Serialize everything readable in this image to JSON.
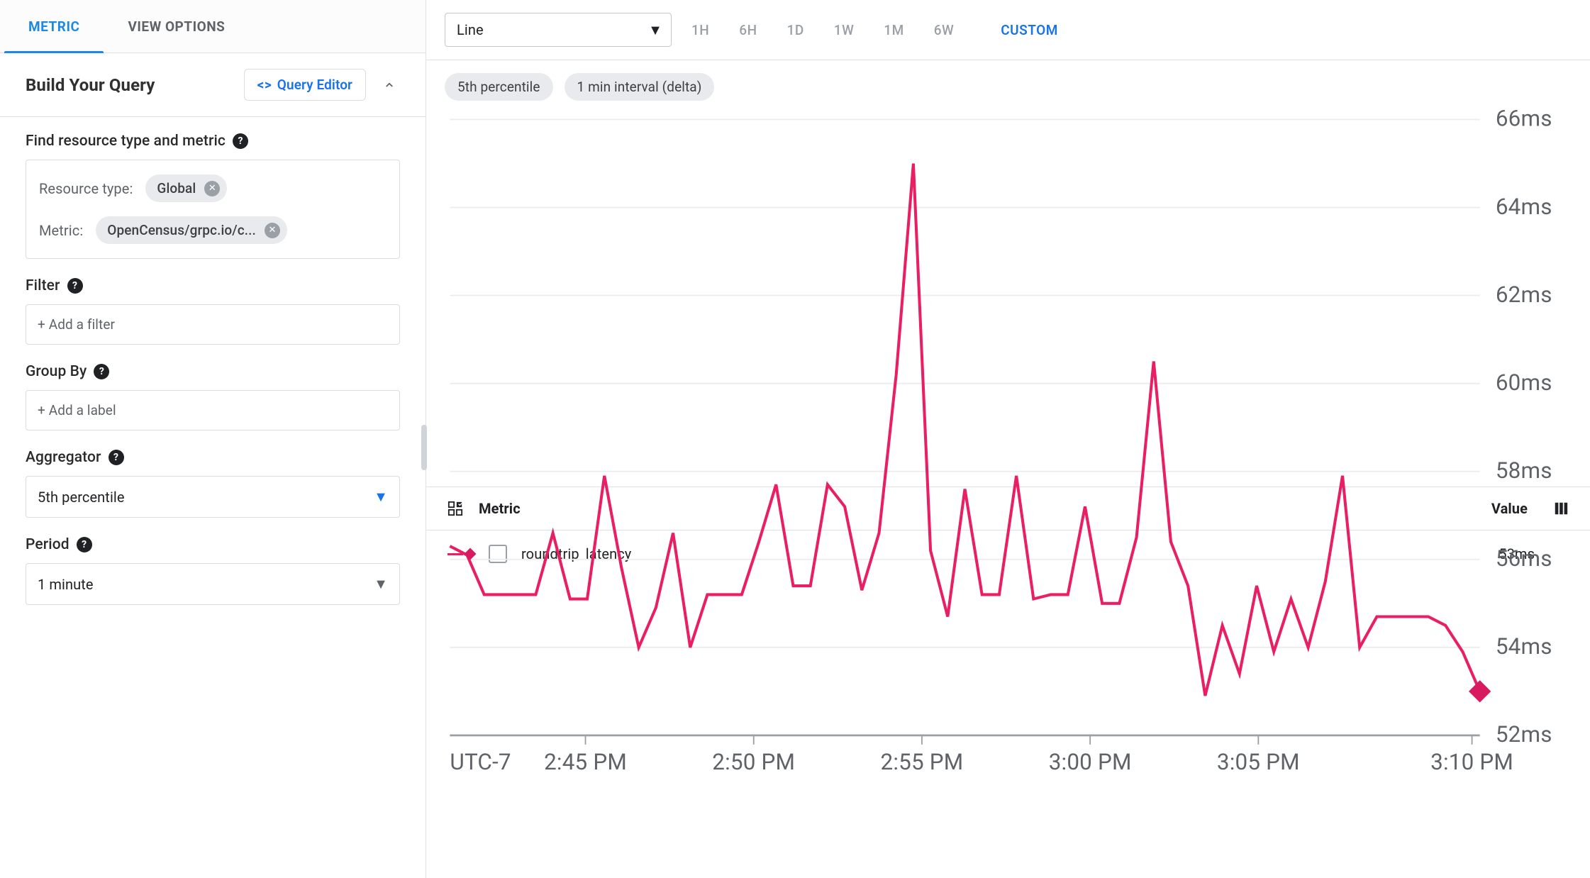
{
  "tabs": {
    "metric": "METRIC",
    "view_options": "VIEW OPTIONS"
  },
  "builder": {
    "title": "Build Your Query",
    "query_editor_btn": "Query Editor",
    "find_label": "Find resource type and metric",
    "resource_type_label": "Resource type:",
    "resource_type_value": "Global",
    "metric_label": "Metric:",
    "metric_value": "OpenCensus/grpc.io/c...",
    "filter_label": "Filter",
    "filter_placeholder": "+ Add a filter",
    "groupby_label": "Group By",
    "groupby_placeholder": "+ Add a label",
    "aggregator_label": "Aggregator",
    "aggregator_value": "5th percentile",
    "period_label": "Period",
    "period_value": "1 minute"
  },
  "right": {
    "chart_type": "Line",
    "ranges": [
      "1H",
      "6H",
      "1D",
      "1W",
      "1M",
      "6W"
    ],
    "custom": "CUSTOM",
    "badge1": "5th percentile",
    "badge2": "1 min interval (delta)",
    "legend_metric": "Metric",
    "legend_value": "Value",
    "series_name": "roundtrip_latency",
    "series_value": "53ms",
    "tz": "UTC-7"
  },
  "chart_data": {
    "type": "line",
    "title": "",
    "xlabel": "",
    "ylabel": "",
    "ylim": [
      52,
      66
    ],
    "y_ticks": [
      52,
      54,
      56,
      58,
      60,
      62,
      64,
      66
    ],
    "y_tick_labels": [
      "52ms",
      "54ms",
      "56ms",
      "58ms",
      "60ms",
      "62ms",
      "64ms",
      "66ms"
    ],
    "x_tick_labels": [
      "2:45 PM",
      "2:50 PM",
      "2:55 PM",
      "3:00 PM",
      "3:05 PM",
      "3:10 PM"
    ],
    "timezone_label": "UTC-7",
    "series": [
      {
        "name": "roundtrip_latency",
        "color": "#e91e63",
        "values": [
          56.3,
          56.1,
          55.2,
          55.2,
          55.2,
          55.2,
          56.6,
          55.1,
          55.1,
          57.9,
          55.8,
          54.0,
          54.9,
          56.6,
          54.0,
          55.2,
          55.2,
          55.2,
          56.4,
          57.7,
          55.4,
          55.4,
          57.7,
          57.2,
          55.3,
          56.6,
          60.2,
          65.0,
          56.2,
          54.7,
          57.6,
          55.2,
          55.2,
          57.9,
          55.1,
          55.2,
          55.2,
          57.2,
          55.0,
          55.0,
          56.5,
          60.5,
          56.4,
          55.4,
          52.9,
          54.5,
          53.4,
          55.4,
          53.9,
          55.1,
          54.0,
          55.5,
          57.9,
          54.0,
          54.7,
          54.7,
          54.7,
          54.7,
          54.5,
          53.9,
          53.0
        ]
      }
    ]
  }
}
